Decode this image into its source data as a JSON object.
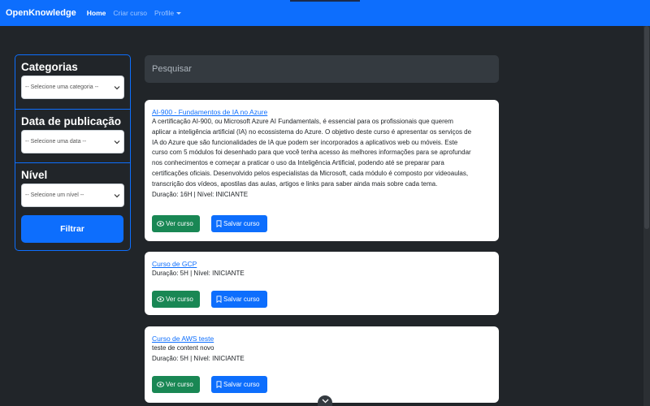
{
  "navbar": {
    "brand": "OpenKnowledge",
    "links": [
      "Home",
      "Criar curso",
      "Profile"
    ]
  },
  "sidebar": {
    "sections": [
      {
        "title": "Categorias",
        "select_value": "-- Selecione uma categoria --"
      },
      {
        "title": "Data de publicação",
        "select_value": "-- Selecione uma data --"
      },
      {
        "title": "Nível",
        "select_value": "-- Selecione um nível --"
      }
    ],
    "filter_label": "Filtrar"
  },
  "search": {
    "placeholder": "Pesquisar"
  },
  "courses": [
    {
      "title": "AI-900 - Fundamentos de IA no Azure",
      "description_lines": [
        "A certificação AI-900, ou Microsoft Azure AI Fundamentals, é essencial para os profissionais que querem",
        "aplicar a inteligência artificial (IA) no ecossistema do Azure. O objetivo deste curso é apresentar os serviços de",
        "IA do Azure que são funcionalidades de IA que podem ser incorporados a aplicativos web ou móveis. Este",
        "curso com 5 módulos foi desenhado para que você tenha acesso às melhores informações para se aprofundar",
        "nos conhecimentos e começar a praticar o uso da Inteligência Artificial, podendo até se preparar para",
        "certificações oficiais. Desenvolvido pelos especialistas da Microsoft, cada módulo é composto por videoaulas,",
        "transcrição dos vídeos, apostilas das aulas, artigos e links para saber ainda mais sobre cada tema."
      ],
      "meta": "Duração: 16H | Nível: INICIANTE"
    },
    {
      "title": "Curso de GCP",
      "description_lines": [],
      "meta": "Duração: 5H | Nível: INICIANTE"
    },
    {
      "title": "Curso de AWS teste",
      "description_lines": [
        "teste de content novo"
      ],
      "meta": "Duração: 5H | Nível: INICIANTE"
    }
  ],
  "buttons": {
    "view": "Ver curso",
    "save": "Salvar curso"
  },
  "colors": {
    "primary": "#0d6efd",
    "success": "#198754",
    "background": "#212529",
    "search_bg": "#343a40"
  }
}
